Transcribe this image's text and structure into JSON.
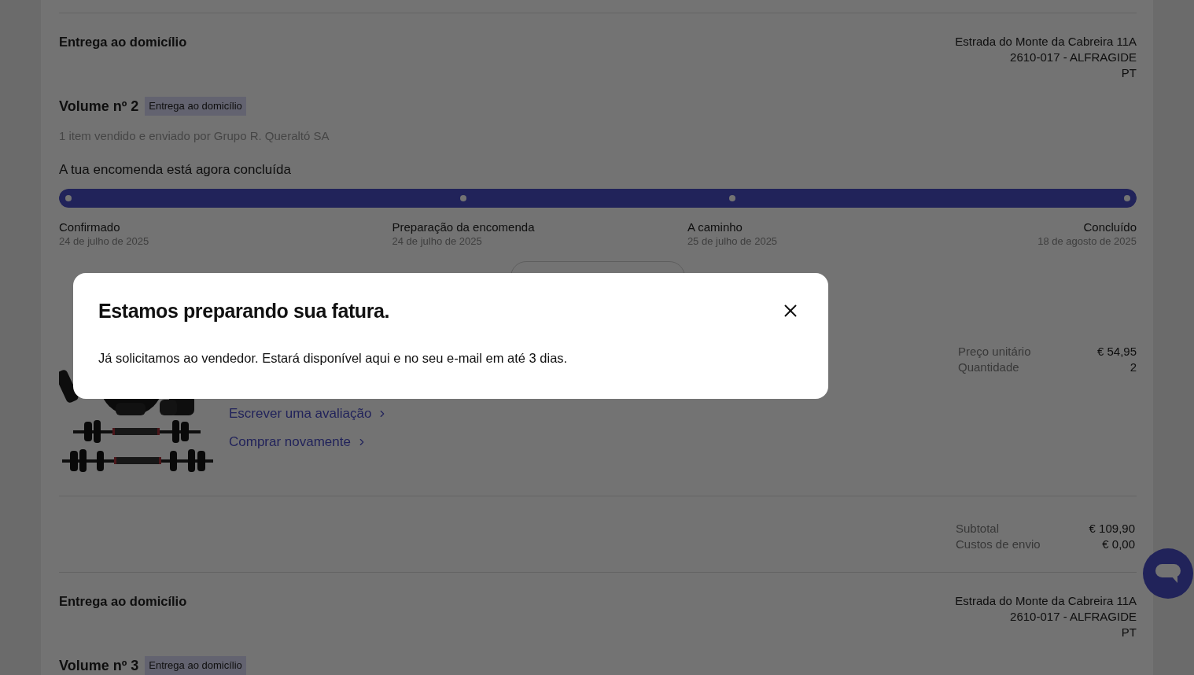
{
  "shipments": [
    {
      "delivery": {
        "title": "Entrega ao domicílio",
        "address": [
          "Estrada do Monte da Cabreira 11A",
          "2610-017 - ALFRAGIDE",
          "PT"
        ]
      },
      "volume": {
        "title": "Volume nº 2",
        "badge": "Entrega ao domicílio"
      },
      "seller_note": "1 item vendido e enviado por Grupo R. Queraltó SA",
      "status": "A tua encomenda está agora concluída",
      "progress": {
        "level": 1,
        "steps": [
          {
            "label": "Confirmado",
            "date": "24 de julho de 2025"
          },
          {
            "label": "Preparação da encomenda",
            "date": "24 de julho de 2025"
          },
          {
            "label": "A caminho",
            "date": "25 de julho de 2025"
          },
          {
            "label": "Concluído",
            "date": "18 de agosto de 2025"
          }
        ]
      },
      "item": {
        "links": [
          "Escrever uma avaliação",
          "Comprar novamente"
        ],
        "details": [
          {
            "label": "Preço unitário",
            "value": "€ 54,95"
          },
          {
            "label": "Quantidade",
            "value": "2"
          }
        ]
      },
      "totals": [
        {
          "label": "Subtotal",
          "value": "€ 109,90"
        },
        {
          "label": "Custos de envio",
          "value": "€ 0,00"
        }
      ]
    },
    {
      "delivery": {
        "title": "Entrega ao domicílio",
        "address": [
          "Estrada do Monte da Cabreira 11A",
          "2610-017 - ALFRAGIDE",
          "PT"
        ]
      },
      "volume": {
        "title": "Volume nº 3",
        "badge": "Entrega ao domicílio"
      }
    }
  ],
  "dialog": {
    "title": "Estamos preparando sua fatura.",
    "message": "Já solicitamos ao vendedor. Estará disponível aqui e no seu e-mail em até 3 dias."
  }
}
